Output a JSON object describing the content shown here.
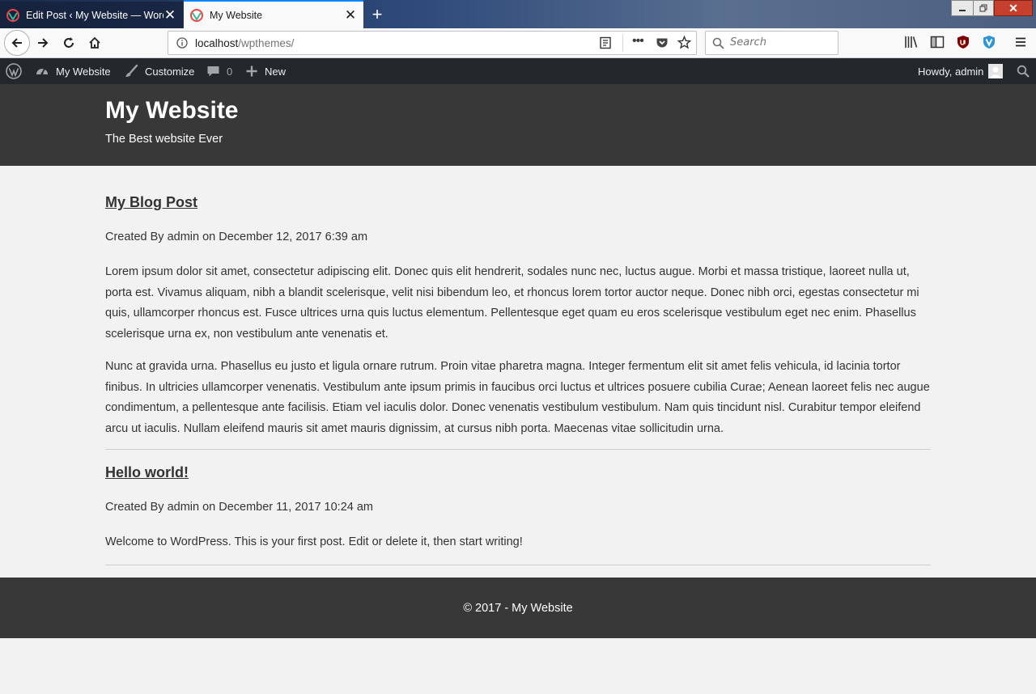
{
  "browser": {
    "tabs": [
      {
        "title": "Edit Post ‹ My Website — WordPress",
        "active": false
      },
      {
        "title": "My Website",
        "active": true
      }
    ],
    "url_host": "localhost",
    "url_path": "/wpthemes/",
    "search_placeholder": "Search",
    "accent_color": "#0a84ff"
  },
  "adminbar": {
    "site_name": "My Website",
    "customize": "Customize",
    "comments_count": "0",
    "new_label": "New",
    "howdy": "Howdy, admin"
  },
  "site": {
    "title": "My Website",
    "tagline": "The Best website Ever"
  },
  "posts": [
    {
      "title": "My Blog Post",
      "meta": "Created By admin on December 12, 2017 6:39 am",
      "paragraphs": [
        "Lorem ipsum dolor sit amet, consectetur adipiscing elit. Donec quis elit hendrerit, sodales nunc nec, luctus augue. Morbi et massa tristique, laoreet nulla ut, porta est. Vivamus aliquam, nibh a blandit scelerisque, velit nisi bibendum leo, et rhoncus lorem tortor auctor neque. Donec nibh orci, egestas consectetur mi quis, ullamcorper rhoncus est. Fusce ultrices urna quis luctus elementum. Pellentesque eget quam eu eros scelerisque vestibulum eget nec enim. Phasellus scelerisque urna ex, non vestibulum ante venenatis et.",
        "Nunc at gravida urna. Phasellus eu justo et ligula ornare rutrum. Proin vitae pharetra magna. Integer fermentum elit sit amet felis vehicula, id lacinia tortor finibus. In ultricies ullamcorper venenatis. Vestibulum ante ipsum primis in faucibus orci luctus et ultrices posuere cubilia Curae; Aenean laoreet felis nec augue condimentum, a pellentesque ante facilisis. Etiam vel iaculis dolor. Donec venenatis vestibulum vestibulum. Nam quis tincidunt nisl. Curabitur tempor eleifend arcu ut iaculis. Nullam eleifend mauris sit amet mauris dignissim, at cursus nibh porta. Maecenas vitae sollicitudin urna."
      ]
    },
    {
      "title": "Hello world!",
      "meta": "Created By admin on December 11, 2017 10:24 am",
      "paragraphs": [
        "Welcome to WordPress. This is your first post. Edit or delete it, then start writing!"
      ]
    }
  ],
  "footer": {
    "text": "© 2017 - My Website"
  },
  "colors": {
    "adminbar": "#23282d",
    "header": "#383838",
    "page_bg": "#f2f2f2"
  }
}
